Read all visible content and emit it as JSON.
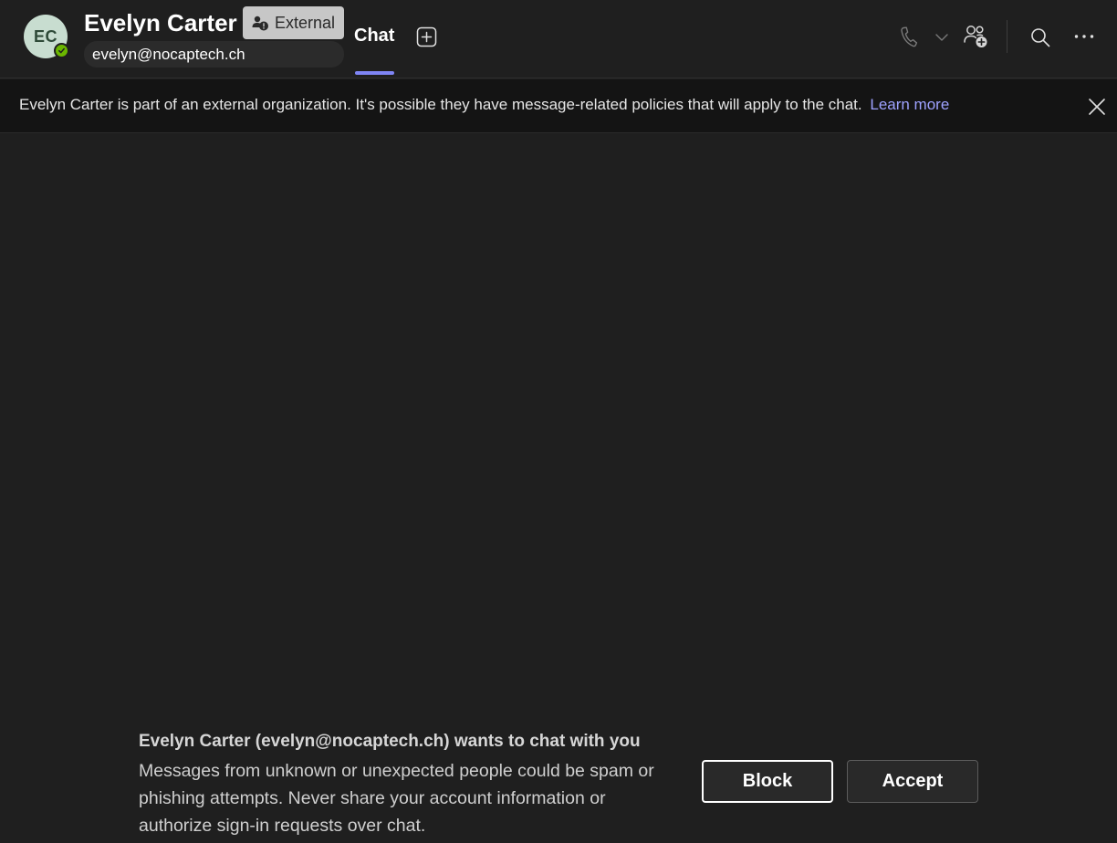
{
  "header": {
    "avatar_initials": "EC",
    "contact_name": "Evelyn Carter",
    "external_badge": "External",
    "email": "evelyn@nocaptech.ch",
    "tab_chat": "Chat"
  },
  "banner": {
    "message": "Evelyn Carter is part of an external organization. It's possible they have message-related policies that will apply to the chat.",
    "link": "Learn more"
  },
  "request": {
    "title": "Evelyn Carter (evelyn@nocaptech.ch) wants to chat with you",
    "body": "Messages from unknown or unexpected people could be spam or phishing attempts. Never share your account information or authorize sign-in requests over chat.",
    "block_label": "Block",
    "accept_label": "Accept"
  },
  "icons": {
    "presence": "available-check-icon",
    "external": "external-org-icon",
    "add_tab": "add-tab-icon",
    "call": "phone-icon",
    "call_dropdown": "chevron-down-icon",
    "people": "add-people-icon",
    "search": "search-icon",
    "more": "more-options-icon",
    "close": "close-icon"
  },
  "colors": {
    "background": "#1f1f1f",
    "banner_background": "#141414",
    "accent": "#7f85f5",
    "link": "#9ea2ff",
    "presence_available": "#6bb700",
    "avatar_bg": "#c8ddd0"
  }
}
